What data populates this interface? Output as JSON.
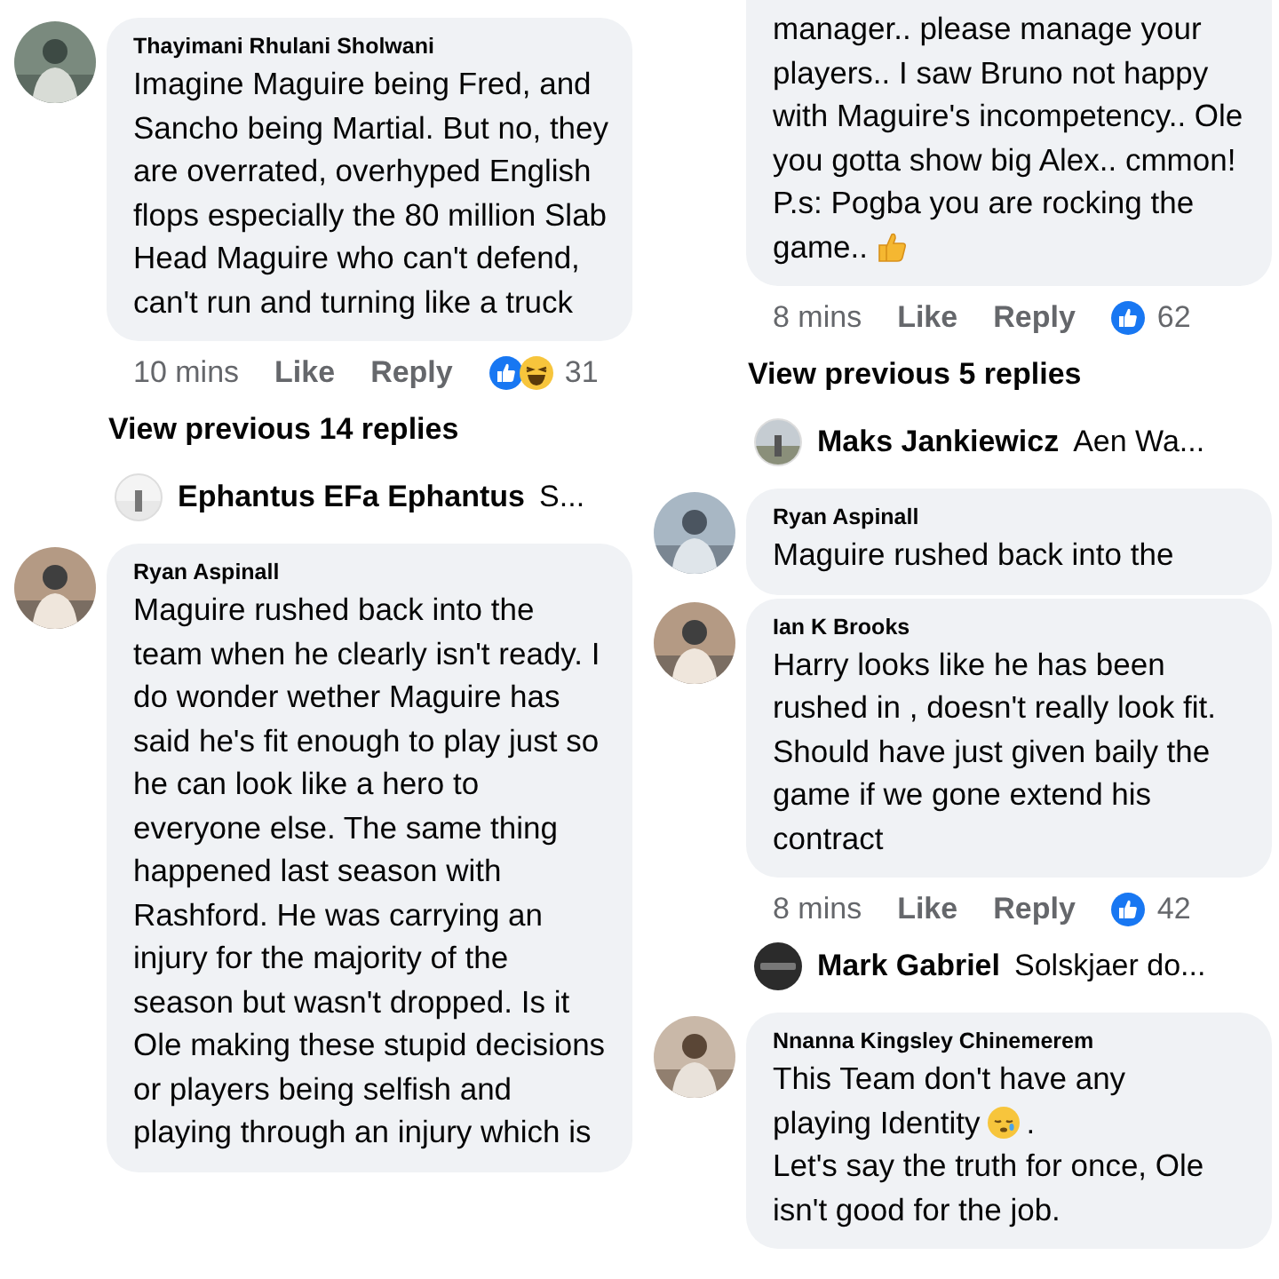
{
  "columns": [
    {
      "items": [
        {
          "kind": "comment",
          "avatar": {
            "kind": "picture"
          },
          "author": "Thayimani Rhulani Sholwani",
          "body": [
            {
              "kind": "text",
              "text": "Imagine Maguire being Fred, and Sancho being Martial. But no, they are overrated, overhyped English flops especially the 80 million Slab Head Maguire who can't defend, can't run and turning like a truck"
            }
          ],
          "meta": {
            "time": "10 mins",
            "like": "Like",
            "reply": "Reply",
            "reactions": [
              {
                "kind": "like"
              },
              {
                "kind": "haha"
              }
            ],
            "count": "31"
          }
        },
        {
          "kind": "view_more",
          "label": "View previous 14 replies"
        },
        {
          "kind": "reply_preview",
          "avatar": {
            "kind": "picture"
          },
          "author": "Ephantus EFa Ephantus",
          "snippet": "S..."
        },
        {
          "kind": "comment",
          "avatar": {
            "kind": "picture"
          },
          "author": "Ryan Aspinall",
          "body": [
            {
              "kind": "text",
              "text": "Maguire rushed back into the team when he clearly isn't ready. I do wonder wether Maguire has said he's fit enough to play just so he can look like a hero to everyone else. The same thing happened last season with Rashford. He was carrying an injury for the majority of the season but wasn't dropped. Is it Ole making these stupid decisions or players being selfish and playing through an injury which is"
            }
          ]
        }
      ]
    },
    {
      "items": [
        {
          "kind": "comment",
          "body": [
            {
              "kind": "text",
              "text": "manager.. please manage your players.. I saw Bruno not happy with Maguire's incompetency.. Ole you gotta show big Alex.. cmmon!\nP.s: Pogba you are rocking the"
            },
            {
              "kind": "inline",
              "text": "game.."
            },
            {
              "kind": "thumb-emoji"
            }
          ],
          "meta": {
            "time": "8 mins",
            "like": "Like",
            "reply": "Reply",
            "reactions": [
              {
                "kind": "like"
              }
            ],
            "count": "62"
          }
        },
        {
          "kind": "view_more",
          "label": "View previous 5 replies"
        },
        {
          "kind": "reply_preview",
          "avatar": {
            "kind": "picture"
          },
          "author": "Maks Jankiewicz",
          "snippet": "Aen Wa..."
        },
        {
          "kind": "comment",
          "avatar": {
            "kind": "picture"
          },
          "author": "Ryan Aspinall",
          "body": [
            {
              "kind": "text",
              "text": "Maguire rushed back into the"
            }
          ]
        },
        {
          "kind": "comment",
          "avatar": {
            "kind": "picture"
          },
          "author": "Ian K Brooks",
          "body": [
            {
              "kind": "text",
              "text": "Harry looks like he has been rushed in , doesn't really look fit. Should have just given baily the game if we gone extend his contract"
            }
          ],
          "meta": {
            "time": "8 mins",
            "like": "Like",
            "reply": "Reply",
            "reactions": [
              {
                "kind": "like"
              }
            ],
            "count": "42"
          }
        },
        {
          "kind": "reply_preview",
          "avatar": {
            "kind": "logo"
          },
          "author": "Mark Gabriel",
          "snippet": "Solskjaer do..."
        },
        {
          "kind": "comment",
          "avatar": {
            "kind": "picture"
          },
          "author": "Nnanna Kingsley Chinemerem",
          "body": [
            {
              "kind": "text",
              "text": "This Team don't have any"
            },
            {
              "kind": "inline",
              "text": "playing Identity"
            },
            {
              "kind": "face-emoji"
            },
            {
              "kind": "inline",
              "text": "."
            },
            {
              "kind": "text",
              "text": "Let's say the truth for once, Ole isn't good for the job."
            }
          ]
        }
      ]
    }
  ]
}
